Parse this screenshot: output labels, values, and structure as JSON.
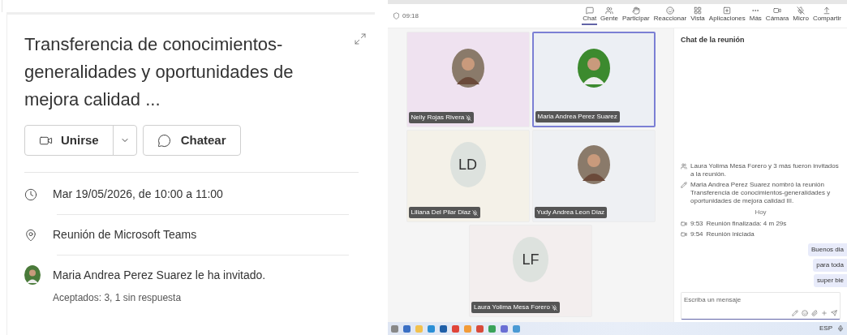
{
  "meeting_card": {
    "title": "Transferencia de conocimientos-generalidades y oportunidades de mejora calidad ...",
    "join_button": "Unirse",
    "chat_button": "Chatear",
    "datetime": "Mar 19/05/2026, de 10:00 a 11:00",
    "location": "Reunión de Microsoft Teams",
    "organizer": "Maria Andrea Perez Suarez le ha invitado.",
    "responses": "Aceptados: 3, 1 sin respuesta"
  },
  "teams_window": {
    "timer": "09:18",
    "toolbar": [
      {
        "kind": "chat",
        "label": "Chat",
        "selected": true
      },
      {
        "kind": "people",
        "label": "Gente",
        "selected": false
      },
      {
        "kind": "hand",
        "label": "Participar",
        "selected": false
      },
      {
        "kind": "react",
        "label": "Reaccionar",
        "selected": false
      },
      {
        "kind": "view",
        "label": "Vista",
        "selected": false
      },
      {
        "kind": "apps",
        "label": "Aplicaciones",
        "selected": false
      },
      {
        "kind": "more",
        "label": "Más",
        "selected": false
      },
      {
        "kind": "camera",
        "label": "Cámara",
        "selected": false
      },
      {
        "kind": "mic",
        "label": "Micro",
        "selected": false
      },
      {
        "kind": "share",
        "label": "Compartir",
        "selected": false
      }
    ],
    "participants": [
      {
        "name": "Nelly Rojas Rivera",
        "kind": "photo",
        "muted": true,
        "active": false
      },
      {
        "name": "Maria Andrea Perez Suarez",
        "kind": "photo",
        "muted": false,
        "active": true
      },
      {
        "name": "Liliana Del Pilar Diaz",
        "kind": "initials",
        "initials": "LD",
        "muted": true,
        "active": false
      },
      {
        "name": "Yudy Andrea Leon Diaz",
        "kind": "photo",
        "muted": false,
        "active": false
      },
      {
        "name": "Laura Yolima Mesa Forero",
        "kind": "initials",
        "initials": "LF",
        "muted": true,
        "active": false
      }
    ],
    "chat": {
      "title": "Chat de la reunión",
      "events": [
        {
          "kind": "invite",
          "text": "Laura Yolima Mesa Forero y 3 más fueron invitados a la reunión."
        },
        {
          "kind": "rename",
          "text": "Maria Andrea Perez Suarez nombró la reunión Transferencia de conocimientos-generalidades y oportunidades de mejora calidad III."
        },
        {
          "kind": "divider",
          "text": "Hoy"
        },
        {
          "kind": "meeting",
          "time": "9:53",
          "text": "Reunión finalizada: 4 m 29s"
        },
        {
          "kind": "meeting",
          "time": "9:54",
          "text": "Reunión iniciada"
        }
      ],
      "messages": [
        "Buenos dia",
        "para toda",
        "super bie"
      ],
      "input": {
        "placeholder": "Escriba un mensaje"
      }
    },
    "taskbar": {
      "language": "ESP"
    }
  }
}
